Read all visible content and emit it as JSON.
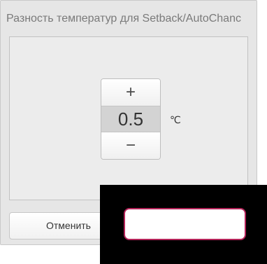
{
  "dialog": {
    "title": "Разность температур для Setback/AutoChanс"
  },
  "stepper": {
    "plus_icon": "plus-icon",
    "plus_glyph": "+",
    "value": "0.5",
    "minus_icon": "minus-icon",
    "minus_glyph": "−",
    "unit": "℃"
  },
  "actions": {
    "cancel_label": "Отменить"
  },
  "colors": {
    "background": "#e6e6e6",
    "value_bg": "#d3d3d3",
    "focus_border": "#b5245a",
    "overlay": "#000000"
  }
}
